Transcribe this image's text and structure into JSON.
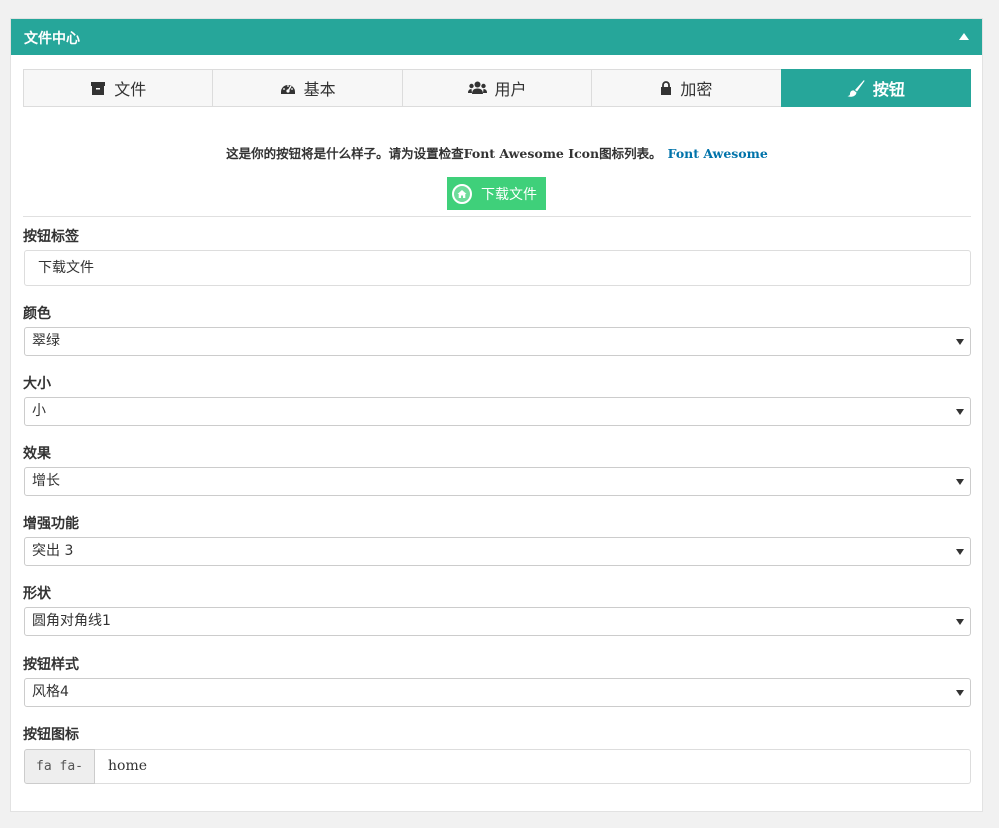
{
  "panel": {
    "title": "文件中心"
  },
  "tabs": [
    {
      "label": "文件",
      "icon": "archive-icon"
    },
    {
      "label": "基本",
      "icon": "dashboard-icon"
    },
    {
      "label": "用户",
      "icon": "users-icon"
    },
    {
      "label": "加密",
      "icon": "lock-icon"
    },
    {
      "label": "按钮",
      "icon": "paint-brush-icon",
      "active": true
    }
  ],
  "description": {
    "text": "这是你的按钮将是什么样子。请为设置检查Font Awesome Icon图标列表。",
    "link": "Font Awesome"
  },
  "preview_button": {
    "label": "下载文件",
    "icon": "home-icon",
    "color": "#3fd07a"
  },
  "fields": {
    "button_label": {
      "label": "按钮标签",
      "value": "下载文件"
    },
    "color": {
      "label": "颜色",
      "value": "翠绿"
    },
    "size": {
      "label": "大小",
      "value": "小"
    },
    "effect": {
      "label": "效果",
      "value": "增长"
    },
    "enhance": {
      "label": "增强功能",
      "value": "突出 3"
    },
    "shape": {
      "label": "形状",
      "value": "圆角对角线1"
    },
    "style": {
      "label": "按钮样式",
      "value": "风格4"
    },
    "icon": {
      "label": "按钮图标",
      "prefix": "fa fa-",
      "value": "home"
    }
  },
  "colors": {
    "accent": "#26a69a",
    "link": "#0073aa"
  }
}
